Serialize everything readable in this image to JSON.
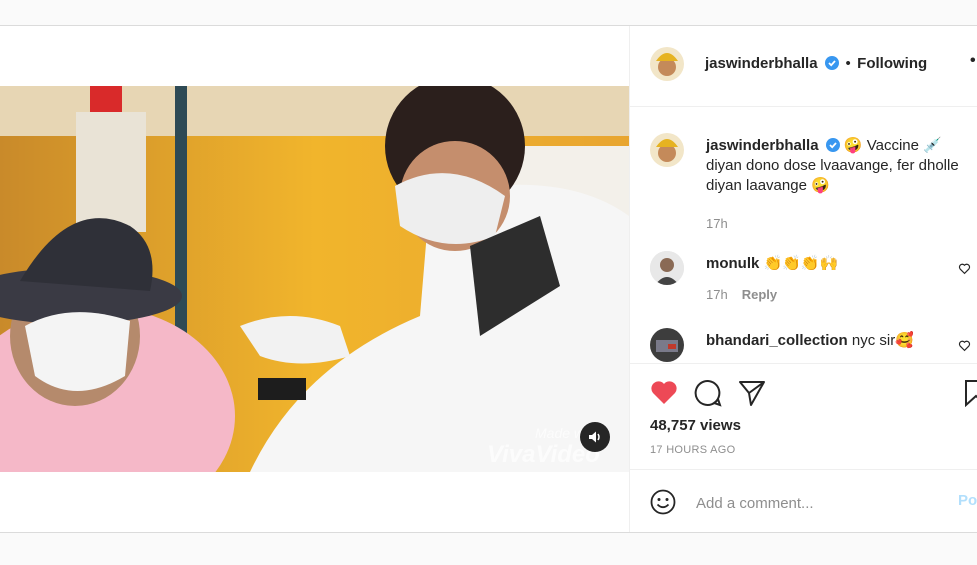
{
  "post": {
    "author": {
      "username": "jaswinderbhalla",
      "verified": true,
      "follow_status": "Following",
      "separator": "•",
      "more_label": "•"
    },
    "media": {
      "type": "video",
      "watermark_line1": "Made with",
      "watermark_line2": "VivaVideo",
      "sound_icon": "speaker-icon"
    },
    "caption": {
      "username": "jaswinderbhalla",
      "text": "🤪 Vaccine 💉 diyan dono dose lvaavange, fer dholle diyan laavange 🤪",
      "time": "17h"
    },
    "comments": [
      {
        "username": "monulk",
        "text": "👏👏👏🙌",
        "time": "17h",
        "reply_label": "Reply"
      },
      {
        "username": "bhandari_collection",
        "text": "nyc sir🥰"
      }
    ],
    "views": "48,757 views",
    "posted_ago": "17 HOURS AGO",
    "add_comment": {
      "placeholder": "Add a comment...",
      "post_label": "Post"
    },
    "colors": {
      "like": "#ed4956",
      "verified": "#3897f0",
      "post_disabled": "#b2dffc"
    }
  }
}
